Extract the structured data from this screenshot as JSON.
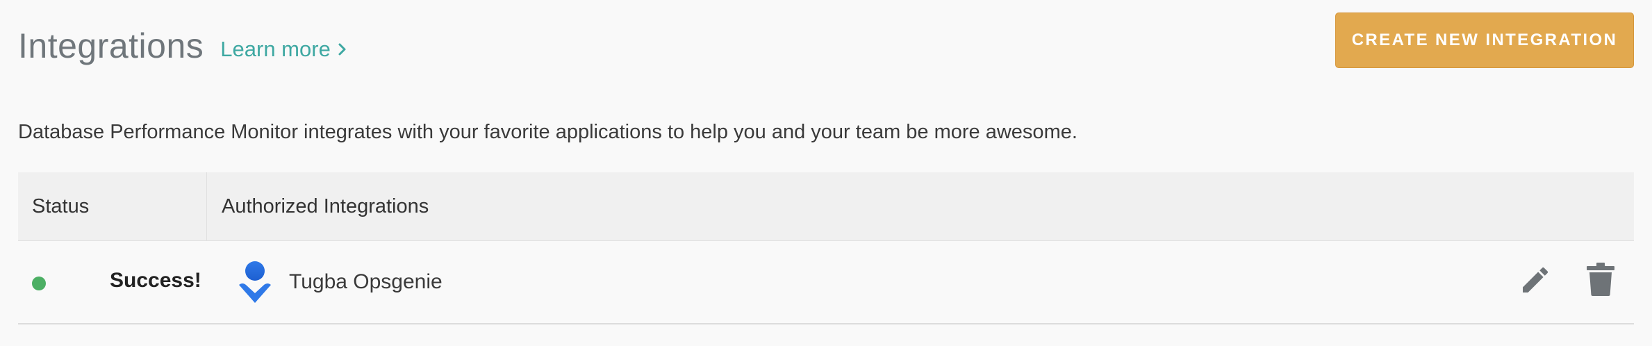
{
  "header": {
    "title": "Integrations",
    "learn_more": "Learn more",
    "create_button": "CREATE NEW INTEGRATION"
  },
  "description": "Database Performance Monitor integrates with your favorite applications to help you and your team be more awesome.",
  "table": {
    "columns": [
      "Status",
      "Authorized Integrations"
    ],
    "rows": [
      {
        "status": "Success!",
        "status_color": "#4caf64",
        "icon": "opsgenie-icon",
        "name": "Tugba Opsgenie",
        "actions": [
          "edit-icon",
          "delete-icon"
        ]
      }
    ]
  },
  "colors": {
    "accent": "#e2a94f",
    "link": "#3ea8a2",
    "success": "#4caf64",
    "icon_gray": "#6e7377",
    "opsgenie_blue": "#2f79e8"
  }
}
